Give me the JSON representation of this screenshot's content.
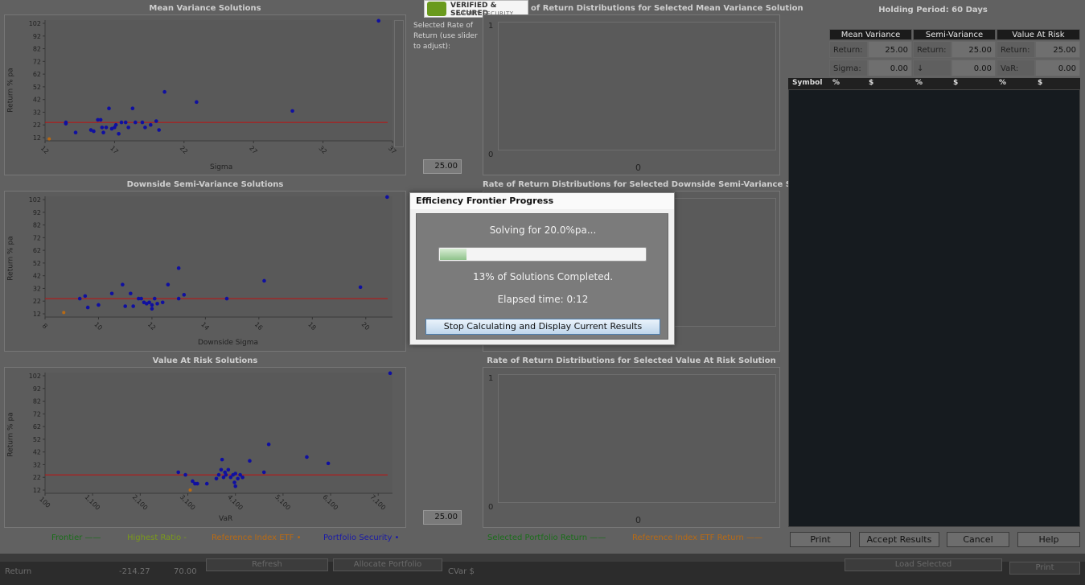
{
  "badge": {
    "line1": "VERIFIED & SECURED",
    "line2": "VERIFY SECURITY"
  },
  "mv_chart": {
    "title": "Mean Variance Solutions",
    "ylabel": "Return % pa",
    "xlabel": "Sigma",
    "yticks": [
      "102",
      "92",
      "82",
      "72",
      "62",
      "52",
      "42",
      "32",
      "22",
      "12"
    ],
    "xticks": [
      "12",
      "17",
      "22",
      "27",
      "32",
      "37"
    ]
  },
  "ds_chart": {
    "title": "Downside Semi-Variance Solutions",
    "ylabel": "Return % pa",
    "xlabel": "Downside Sigma",
    "yticks": [
      "102",
      "92",
      "82",
      "72",
      "62",
      "52",
      "42",
      "32",
      "22",
      "12"
    ],
    "xticks": [
      "8",
      "10",
      "12",
      "14",
      "16",
      "18",
      "20"
    ]
  },
  "var_chart": {
    "title": "Value At Risk Solutions",
    "ylabel": "Return % pa",
    "xlabel": "VaR",
    "yticks": [
      "102",
      "92",
      "82",
      "72",
      "62",
      "52",
      "42",
      "32",
      "22",
      "12"
    ],
    "xticks": [
      "100",
      "1,100",
      "2,100",
      "3,100",
      "4,100",
      "5,100",
      "6,100",
      "7,100"
    ]
  },
  "slider": {
    "label": "Selected Rate of Return (use slider to adjust):",
    "value_top": "25.00",
    "value_bottom": "25.00"
  },
  "dist_mv": {
    "title": "of Return Distributions for Selected Mean Variance Solution",
    "ytop": "1",
    "ybottom": "0",
    "xzero": "0"
  },
  "dist_ds": {
    "title": "Rate of Return Distributions for Selected Downside Semi-Variance Solution"
  },
  "dist_var": {
    "title": "Rate of Return Distributions for Selected Value At Risk Solution",
    "ytop": "1",
    "ybottom": "0",
    "xzero": "0"
  },
  "holding_period": "Holding Period: 60 Days",
  "metrics": {
    "mv": {
      "header": "Mean Variance",
      "r_label": "Return:",
      "r_value": "25.00",
      "s_label": "Sigma:",
      "s_value": "0.00"
    },
    "sv": {
      "header": "Semi-Variance",
      "r_label": "Return:",
      "r_value": "25.00",
      "s_label": "↓ Sigma:",
      "s_value": "0.00"
    },
    "var": {
      "header": "Value At Risk",
      "r_label": "Return:",
      "r_value": "25.00",
      "s_label": "VaR:",
      "s_value": "0.00"
    }
  },
  "symbols_table": {
    "headers": [
      "Symbol",
      "%",
      "$",
      "%",
      "$",
      "%",
      "$"
    ]
  },
  "buttons": {
    "print": "Print",
    "accept": "Accept Results",
    "cancel": "Cancel",
    "help": "Help"
  },
  "legend": {
    "frontier": "Frontier ——",
    "highest": "Highest Ratio -",
    "ref_etf": "Reference Index ETF •",
    "portfolio": "Portfolio Security •",
    "sel_return": "Selected Portfolio Return ——",
    "ref_return": "Reference Index ETF Return ——"
  },
  "colors": {
    "frontier": "#1a6e1a",
    "highest": "#7a9a1a",
    "ref_etf": "#b86a14",
    "portfolio": "#1a1aa8",
    "dot": "#1010a0",
    "line": "#c01010"
  },
  "bottombar": {
    "return_label": "Return",
    "return_value": "-214.27",
    "return_value2": "70.00",
    "refresh": "Refresh",
    "allocate": "Allocate Portfolio",
    "cvar": "CVar $",
    "load": "Load Selected",
    "print": "Print"
  },
  "dialog": {
    "title": "Efficiency Frontier Progress",
    "solving": "Solving for 20.0%pa...",
    "progress": 0.13,
    "completed": "13% of Solutions Completed.",
    "elapsed": "Elapsed time: 0:12",
    "stop": "Stop Calculating and Display Current Results"
  },
  "chart_data": [
    {
      "type": "scatter",
      "title": "Mean Variance Solutions",
      "xlabel": "Sigma",
      "ylabel": "Return % pa",
      "xlim": [
        12,
        37
      ],
      "ylim": [
        12,
        102
      ],
      "hline": 24,
      "series": [
        {
          "name": "Portfolio Security",
          "x": [
            36,
            13.5,
            13.5,
            14.2,
            15.3,
            15.5,
            15.8,
            16.0,
            16.1,
            16.2,
            16.4,
            16.6,
            16.8,
            17.0,
            17.1,
            17.3,
            17.5,
            17.8,
            18.0,
            18.3,
            18.5,
            19.0,
            19.2,
            19.6,
            20.0,
            20.2,
            20.6,
            22.9,
            29.8
          ],
          "y": [
            104,
            24,
            23,
            16,
            18,
            17,
            26,
            26,
            20,
            16,
            20,
            35,
            19,
            20,
            22,
            15,
            24,
            24,
            20,
            35,
            24,
            24,
            20,
            22,
            25,
            18,
            48,
            40,
            33
          ]
        }
      ],
      "ref": [
        {
          "x": 12.3,
          "y": 11
        }
      ]
    },
    {
      "type": "scatter",
      "title": "Downside Semi-Variance Solutions",
      "xlabel": "Downside Sigma",
      "ylabel": "Return % pa",
      "xlim": [
        8,
        21
      ],
      "ylim": [
        12,
        102
      ],
      "hline": 24,
      "series": [
        {
          "name": "Portfolio Security",
          "x": [
            20.8,
            9.3,
            9.5,
            9.6,
            10.0,
            10.5,
            10.9,
            11.0,
            11.2,
            11.3,
            11.5,
            11.6,
            11.7,
            11.8,
            11.9,
            12.0,
            12.0,
            12.1,
            12.2,
            12.4,
            12.6,
            13.0,
            13.0,
            13.2,
            14.8,
            16.2,
            19.8
          ],
          "y": [
            104,
            24,
            26,
            17,
            19,
            28,
            35,
            18,
            28,
            18,
            24,
            24,
            21,
            20,
            21,
            19,
            16,
            24,
            20,
            21,
            35,
            48,
            24,
            27,
            24,
            38,
            33
          ]
        }
      ],
      "ref": [
        {
          "x": 8.7,
          "y": 13
        }
      ]
    },
    {
      "type": "scatter",
      "title": "Value At Risk Solutions",
      "xlabel": "VaR",
      "ylabel": "Return % pa",
      "xlim": [
        100,
        7400
      ],
      "ylim": [
        12,
        102
      ],
      "hline": 24,
      "series": [
        {
          "name": "Portfolio Security",
          "x": [
            7350,
            2900,
            3050,
            3200,
            3250,
            3300,
            3500,
            3700,
            3750,
            3800,
            3820,
            3850,
            3880,
            3900,
            3950,
            4000,
            4050,
            4100,
            4100,
            4150,
            4200,
            4250,
            4400,
            4700,
            4800,
            5600,
            6050,
            4080
          ],
          "y": [
            104,
            26,
            24,
            19,
            17,
            17,
            17,
            21,
            24,
            28,
            36,
            22,
            26,
            24,
            28,
            22,
            24,
            25,
            15,
            21,
            24,
            22,
            35,
            26,
            48,
            38,
            33,
            18
          ]
        }
      ],
      "ref": [
        {
          "x": 3150,
          "y": 12
        }
      ]
    }
  ]
}
